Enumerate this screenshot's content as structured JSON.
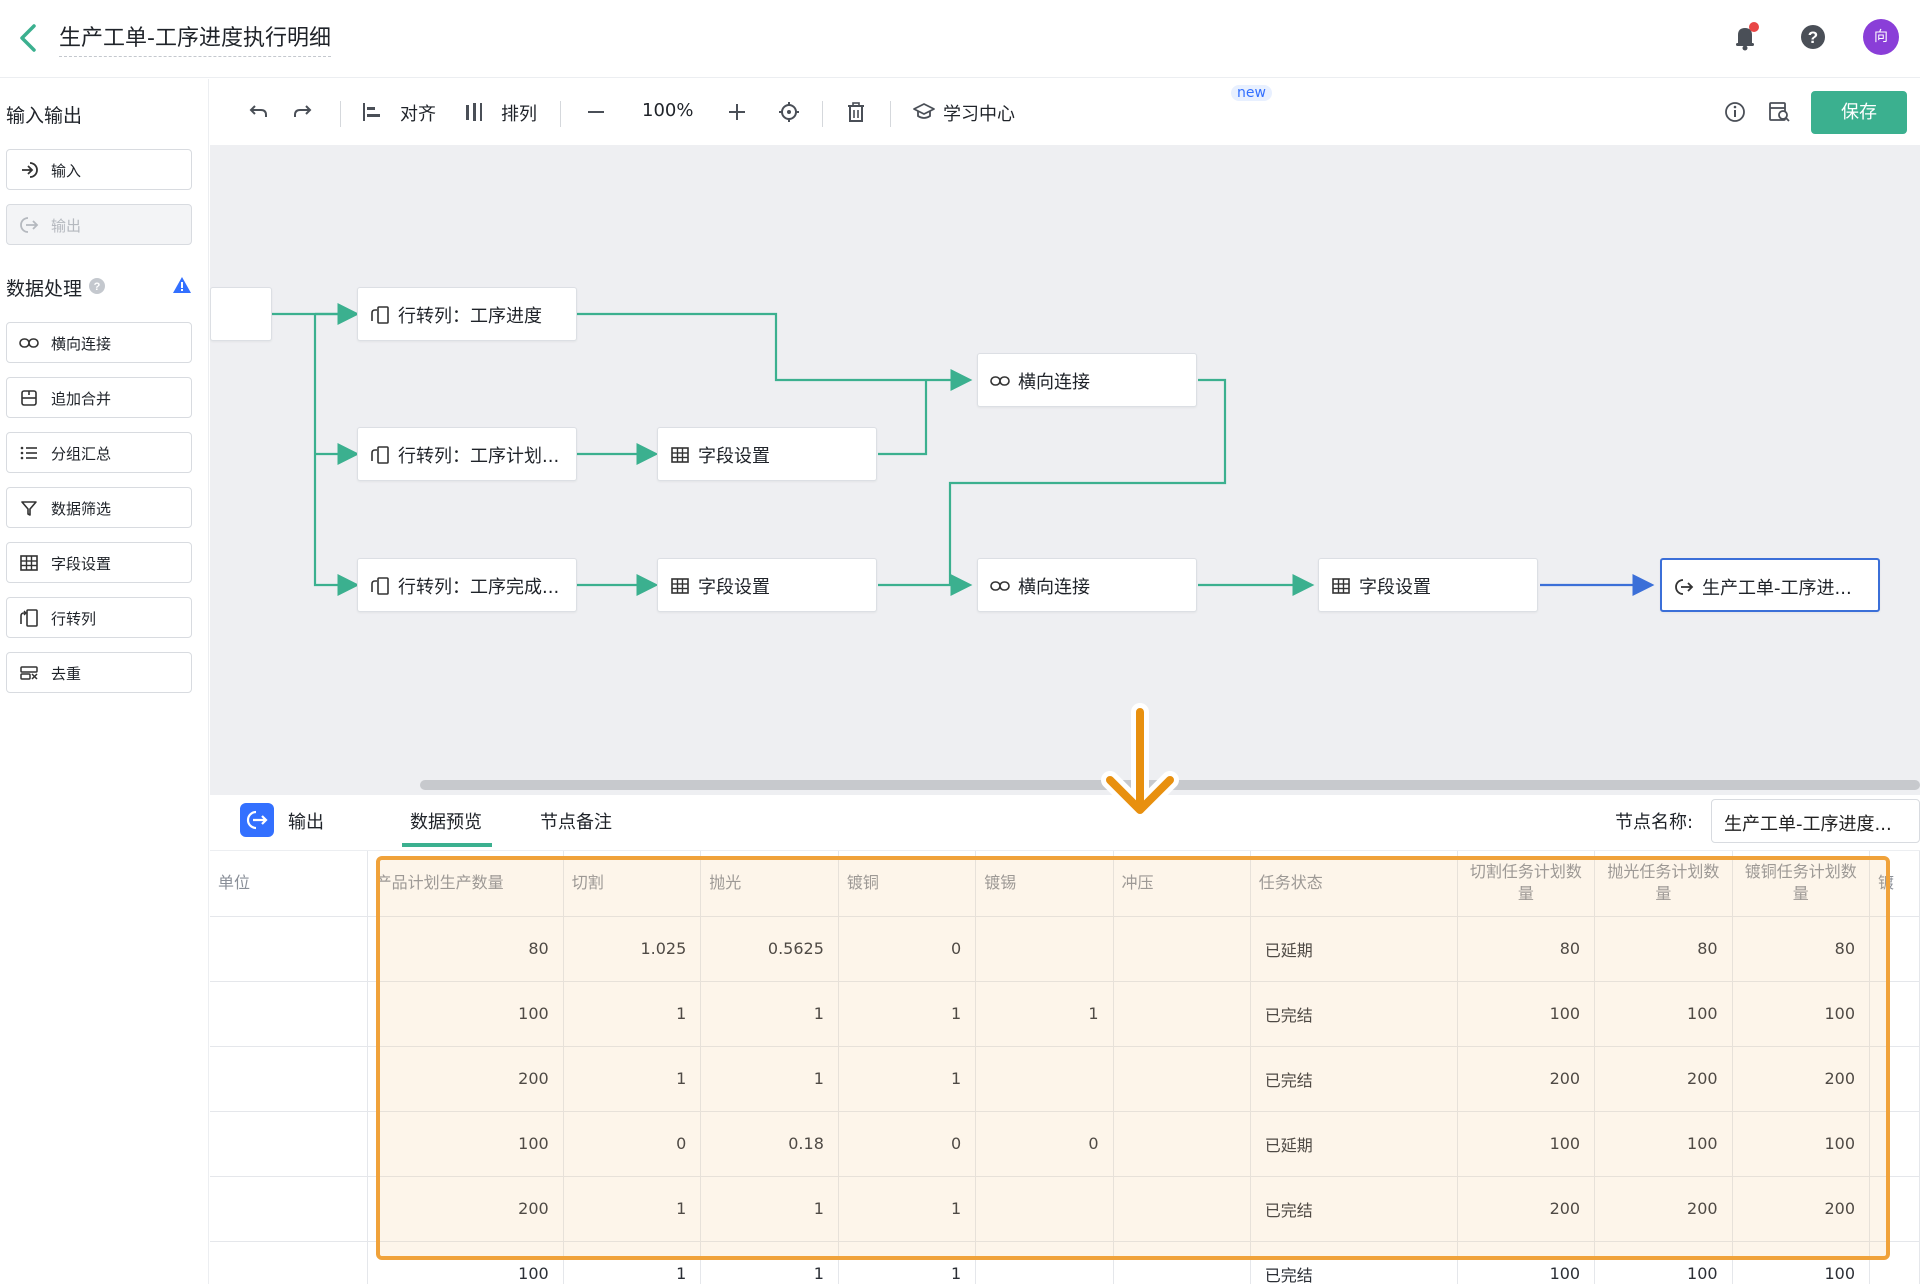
{
  "header": {
    "title": "生产工单-工序进度执行明细",
    "avatar_text": "向"
  },
  "sidebar": {
    "io_heading": "输入输出",
    "input_label": "输入",
    "output_label": "输出",
    "processing_heading": "数据处理",
    "items": [
      {
        "label": "横向连接",
        "icon": "link-icon"
      },
      {
        "label": "追加合并",
        "icon": "merge-icon"
      },
      {
        "label": "分组汇总",
        "icon": "list-icon"
      },
      {
        "label": "数据筛选",
        "icon": "filter-icon"
      },
      {
        "label": "字段设置",
        "icon": "table-icon"
      },
      {
        "label": "行转列",
        "icon": "pivot-icon"
      },
      {
        "label": "去重",
        "icon": "dedupe-icon"
      }
    ]
  },
  "toolbar": {
    "align_label": "对齐",
    "arrange_label": "排列",
    "zoom": "100%",
    "learning_label": "学习中心",
    "new_badge": "new",
    "save_label": "保存"
  },
  "canvas": {
    "nodes": {
      "pivot_progress": "行转列：工序进度",
      "pivot_plan": "行转列：工序计划...",
      "pivot_done": "行转列：工序完成...",
      "field_1": "字段设置",
      "field_2": "字段设置",
      "field_3": "字段设置",
      "join_1": "横向连接",
      "join_2": "横向连接",
      "output": "生产工单-工序进..."
    },
    "colors": {
      "link": "#3bb08f",
      "output_link": "#3b6fd8"
    }
  },
  "panel": {
    "output_label": "输出",
    "tab_preview": "数据预览",
    "tab_notes": "节点备注",
    "node_name_label": "节点名称:",
    "node_name_value": "生产工单-工序进度..."
  },
  "table": {
    "headers": [
      "单位",
      "产品计划生产数量",
      "切割",
      "抛光",
      "镀铜",
      "镀锡",
      "冲压",
      "任务状态",
      "切割任务计划数量",
      "抛光任务计划数量",
      "镀铜任务计划数量",
      "镀"
    ],
    "rows": [
      [
        "",
        "80",
        "1.025",
        "0.5625",
        "0",
        "",
        "",
        "已延期",
        "80",
        "80",
        "80",
        ""
      ],
      [
        "",
        "100",
        "1",
        "1",
        "1",
        "1",
        "",
        "已完结",
        "100",
        "100",
        "100",
        ""
      ],
      [
        "",
        "200",
        "1",
        "1",
        "1",
        "",
        "",
        "已完结",
        "200",
        "200",
        "200",
        ""
      ],
      [
        "",
        "100",
        "0",
        "0.18",
        "0",
        "0",
        "",
        "已延期",
        "100",
        "100",
        "100",
        ""
      ],
      [
        "",
        "200",
        "1",
        "1",
        "1",
        "",
        "",
        "已完结",
        "200",
        "200",
        "200",
        ""
      ],
      [
        "",
        "100",
        "1",
        "1",
        "1",
        "",
        "",
        "已完结",
        "100",
        "100",
        "100",
        ""
      ]
    ]
  }
}
